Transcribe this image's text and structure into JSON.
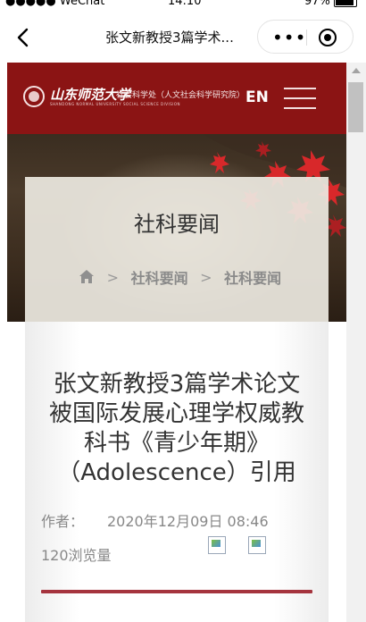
{
  "status_bar": {
    "carrier": "●●●●● WeChat",
    "time": "14:10",
    "battery": "97%"
  },
  "nav": {
    "title": "张文新教授3篇学术...",
    "more_icon": "more-dots-icon",
    "close_icon": "mini-program-close-icon"
  },
  "header": {
    "logo_name": "山东师范大学",
    "logo_dept": "社会科学处（人文社会科学研究院）",
    "logo_sub": "SHANDONG NORMAL UNIVERSITY SOCIAL SCIENCE DIVISION",
    "lang_label": "EN",
    "brand_color": "#8b1414"
  },
  "banner": {
    "category_title": "社科要闻"
  },
  "breadcrumb": {
    "items": [
      "社科要闻",
      "社科要闻"
    ]
  },
  "article": {
    "title_line1": "张文新教授3篇学术论文",
    "title_line2": "被国际发展心理学权威教",
    "title_line3": "科书《青少年期》",
    "title_line4": "（Adolescence）引用",
    "author_label": "作者：",
    "date": "2020年12月09日 08:46",
    "views": "120浏览量",
    "accent_color": "#a5343e"
  }
}
